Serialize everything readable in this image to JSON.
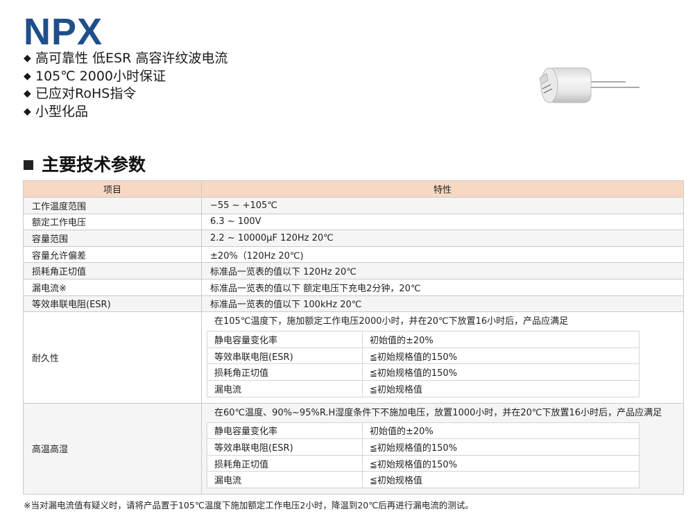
{
  "title": "NPX",
  "features": [
    "高可靠性 低ESR 高容许纹波电流",
    "105℃ 2000小时保证",
    "已应对RoHS指令",
    "小型化品"
  ],
  "feature_bullet": "◆",
  "capacitor_image": {
    "icon": "capacitor-icon"
  },
  "section_heading": "主要技术参数",
  "table": {
    "header": {
      "item": "项目",
      "char": "特性"
    },
    "rows": [
      {
        "item": "工作温度范围",
        "value": "−55 ~ +105℃"
      },
      {
        "item": "额定工作电压",
        "value": "6.3 ~ 100V"
      },
      {
        "item": "容量范围",
        "value": "2.2 ~ 10000μF  120Hz 20℃"
      },
      {
        "item": "容量允许偏差",
        "value": "±20%（120Hz 20℃)"
      },
      {
        "item": "损耗角正切值",
        "value": "标准品一览表的值以下  120Hz 20℃"
      },
      {
        "item": "漏电流※",
        "value": "标准品一览表的值以下  额定电压下充电2分钟，20℃"
      },
      {
        "item": "等效串联电阻(ESR)",
        "value": "标准品一览表的值以下  100kHz 20℃"
      }
    ],
    "durability": {
      "item": "耐久性",
      "lead": "在105℃温度下，施加额定工作电压2000小时，并在20℃下放置16小时后，产品应满足",
      "rows": [
        {
          "k": "静电容量变化率",
          "v": "初始值的±20%"
        },
        {
          "k": "等效串联电阻(ESR)",
          "v": "≦初始规格值的150%"
        },
        {
          "k": "损耗角正切值",
          "v": "≦初始规格值的150%"
        },
        {
          "k": "漏电流",
          "v": "≦初始规格值"
        }
      ]
    },
    "humidity": {
      "item": "高温高湿",
      "lead": "在60℃温度、90%~95%R.H湿度条件下不施加电压，放置1000小时，并在20℃下放置16小时后，产品应满足",
      "rows": [
        {
          "k": "静电容量变化率",
          "v": "初始值的±20%"
        },
        {
          "k": "等效串联电阻(ESR)",
          "v": "≦初始规格值的150%"
        },
        {
          "k": "损耗角正切值",
          "v": "≦初始规格值的150%"
        },
        {
          "k": "漏电流",
          "v": "≦初始规格值"
        }
      ]
    }
  },
  "footnote": "※当对漏电流值有疑义时，请将产品置于105℃温度下施加额定工作电压2小时，降温到20℃后再进行漏电流的测试。"
}
